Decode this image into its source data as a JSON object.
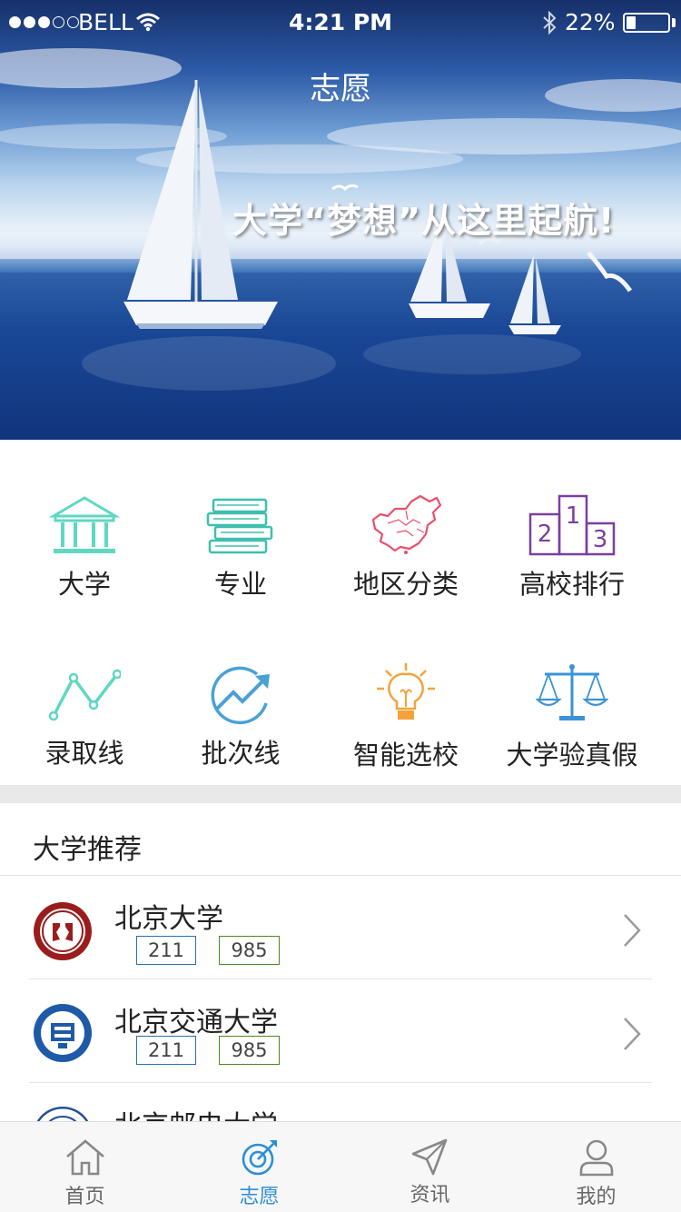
{
  "status_bar": {
    "carrier": "BELL",
    "time": "4:21 PM",
    "battery_percent": "22%",
    "battery_level": 0.22
  },
  "header": {
    "title": "志愿",
    "banner_slogan": "大学“梦想”从这里起航!"
  },
  "categories": [
    {
      "label": "大学",
      "icon": "institution-icon",
      "color": "#5fd7c2"
    },
    {
      "label": "专业",
      "icon": "books-icon",
      "color": "#3fbfae"
    },
    {
      "label": "地区分类",
      "icon": "china-map-icon",
      "color": "#e8506a"
    },
    {
      "label": "高校排行",
      "icon": "podium-icon",
      "color": "#7b3fa0"
    },
    {
      "label": "录取线",
      "icon": "line-graph-icon",
      "color": "#5fd7c2"
    },
    {
      "label": "批次线",
      "icon": "trend-arrow-icon",
      "color": "#4aa1d8"
    },
    {
      "label": "智能选校",
      "icon": "lightbulb-icon",
      "color": "#f3a33a"
    },
    {
      "label": "大学验真假",
      "icon": "scales-icon",
      "color": "#3a93d6"
    }
  ],
  "podium_numbers": [
    "1",
    "2",
    "3"
  ],
  "recommend": {
    "title": "大学推荐",
    "universities": [
      {
        "name": "北京大学",
        "tags": [
          "211",
          "985"
        ],
        "logo": "pku-logo"
      },
      {
        "name": "北京交通大学",
        "tags": [
          "211",
          "985"
        ],
        "logo": "bjtu-logo"
      },
      {
        "name": "北京邮电大学",
        "tags": [],
        "logo": "bupt-logo"
      }
    ]
  },
  "tabbar": {
    "active": "volunteer",
    "accent_color": "#2b8ed8",
    "tabs": [
      {
        "label": "首页",
        "icon": "home-icon"
      },
      {
        "label": "志愿",
        "icon": "target-icon"
      },
      {
        "label": "资讯",
        "icon": "send-icon"
      },
      {
        "label": "我的",
        "icon": "user-icon"
      }
    ]
  }
}
